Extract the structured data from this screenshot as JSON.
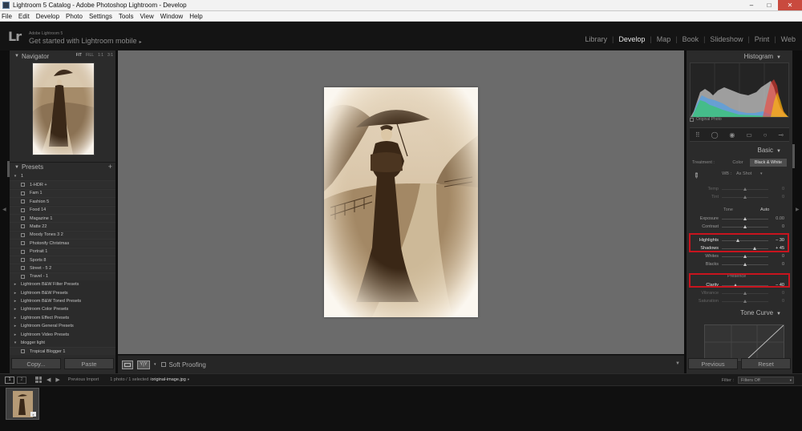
{
  "window": {
    "title": "Lightroom 5 Catalog - Adobe Photoshop Lightroom - Develop",
    "buttons": [
      "–",
      "□",
      "✕"
    ]
  },
  "menubar": [
    "File",
    "Edit",
    "Develop",
    "Photo",
    "Settings",
    "Tools",
    "View",
    "Window",
    "Help"
  ],
  "identity": {
    "logo": "Lr",
    "small": "Adobe Lightroom 5",
    "main": "Get started with Lightroom mobile",
    "arrow": "▸"
  },
  "modules": [
    {
      "label": "Library",
      "active": false
    },
    {
      "label": "Develop",
      "active": true
    },
    {
      "label": "Map",
      "active": false
    },
    {
      "label": "Book",
      "active": false
    },
    {
      "label": "Slideshow",
      "active": false
    },
    {
      "label": "Print",
      "active": false
    },
    {
      "label": "Web",
      "active": false
    }
  ],
  "navigator": {
    "title": "Navigator",
    "zoom": [
      "FIT",
      "FILL",
      "1:1",
      "3:1"
    ],
    "zoom_active": "FIT"
  },
  "presets": {
    "title": "Presets",
    "plus": "+",
    "items": [
      {
        "label": "1",
        "type": "folder-open"
      },
      {
        "label": "1-HDR +",
        "type": "child"
      },
      {
        "label": "Fam 1",
        "type": "child"
      },
      {
        "label": "Fashion 5",
        "type": "child"
      },
      {
        "label": "Food 14",
        "type": "child"
      },
      {
        "label": "Magazine 1",
        "type": "child"
      },
      {
        "label": "Matte 22",
        "type": "child"
      },
      {
        "label": "Moody Tones 3 2",
        "type": "child"
      },
      {
        "label": "Photonify Christmas",
        "type": "child"
      },
      {
        "label": "Portrait 1",
        "type": "child"
      },
      {
        "label": "Sports 8",
        "type": "child"
      },
      {
        "label": "Street - 5 2",
        "type": "child"
      },
      {
        "label": "Travel - 1",
        "type": "child"
      },
      {
        "label": "Lightroom B&W Filter Presets",
        "type": "folder"
      },
      {
        "label": "Lightroom B&W Presets",
        "type": "folder"
      },
      {
        "label": "Lightroom B&W Toned Presets",
        "type": "folder"
      },
      {
        "label": "Lightroom Color Presets",
        "type": "folder"
      },
      {
        "label": "Lightroom Effect Presets",
        "type": "folder"
      },
      {
        "label": "Lightroom General Presets",
        "type": "folder"
      },
      {
        "label": "Lightroom Video Presets",
        "type": "folder"
      },
      {
        "label": "blogger light",
        "type": "folder-open"
      },
      {
        "label": "Tropical Blogger 1",
        "type": "child"
      }
    ]
  },
  "left_buttons": {
    "copy": "Copy...",
    "paste": "Paste"
  },
  "center_toolbar": {
    "view_yy": "Y|Y",
    "soft_proofing": "Soft Proofing"
  },
  "histogram": {
    "title": "Histogram",
    "original_photo": "Original Photo"
  },
  "basic": {
    "title": "Basic",
    "treatment_label": "Treatment :",
    "treatment_options": [
      "Color",
      "Black & White"
    ],
    "treatment_selected": "Black & White",
    "wb_label": "WB :",
    "wb_value": "As Shot",
    "tone_label": "Tone",
    "auto_label": "Auto",
    "presence_label": "Presence",
    "sliders": [
      {
        "label": "Temp",
        "value": "0",
        "pos": 0.5,
        "dim": true
      },
      {
        "label": "Tint",
        "value": "0",
        "pos": 0.5,
        "dim": true
      },
      {
        "label": "Exposure",
        "value": "0.00",
        "pos": 0.5
      },
      {
        "label": "Contrast",
        "value": "0",
        "pos": 0.5
      },
      {
        "label": "Highlights",
        "value": "– 30",
        "pos": 0.35,
        "hi": true
      },
      {
        "label": "Shadows",
        "value": "+ 45",
        "pos": 0.72,
        "hi": true
      },
      {
        "label": "Whites",
        "value": "0",
        "pos": 0.5
      },
      {
        "label": "Blacks",
        "value": "0",
        "pos": 0.5
      },
      {
        "label": "Clarity",
        "value": "– 40",
        "pos": 0.3,
        "hi": true
      },
      {
        "label": "Vibrance",
        "value": "0",
        "pos": 0.5,
        "dim": true
      },
      {
        "label": "Saturation",
        "value": "0",
        "pos": 0.5,
        "dim": true
      }
    ]
  },
  "tone_curve": {
    "title": "Tone Curve"
  },
  "right_buttons": {
    "previous": "Previous",
    "reset": "Reset"
  },
  "filmstrip_bar": {
    "screens": [
      "1",
      "2"
    ],
    "source": "Previous Import",
    "count": "1 photo / 1 selected /",
    "file": "original-image.jpg",
    "filter_label": "Filter :",
    "filter_value": "Filters Off"
  },
  "colors": {
    "accent_highlight": "#c8141e",
    "panel_bg": "#2b2b2b",
    "canvas_bg": "#6b6b6b"
  }
}
